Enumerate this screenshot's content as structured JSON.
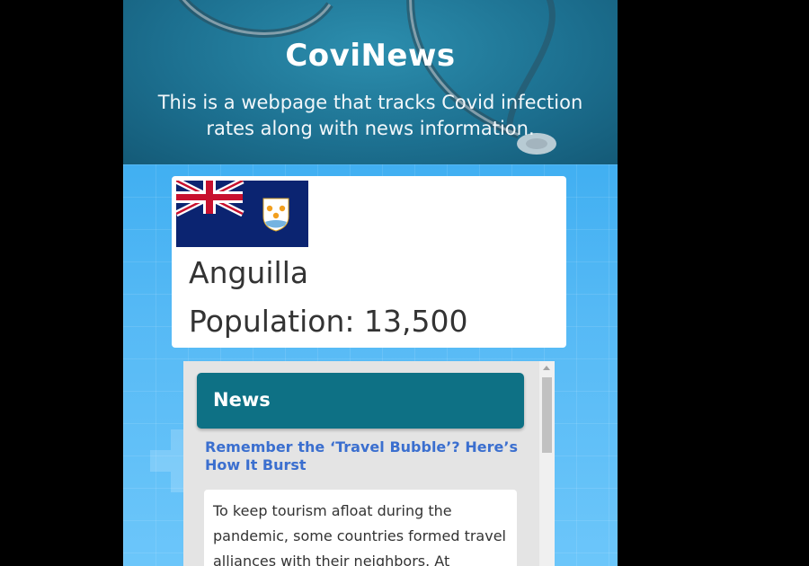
{
  "header": {
    "title": "CoviNews",
    "subtitle": "This is a webpage that tracks Covid infection rates along with news information."
  },
  "country": {
    "name": "Anguilla",
    "population_label": "Population:",
    "population_value": "13,500",
    "flag_icon": "anguilla-flag"
  },
  "news": {
    "heading": "News",
    "articles": [
      {
        "title": "Remember the ‘Travel Bubble’? Here’s How It Burst",
        "summary": "To keep tourism afloat during the pandemic, some countries formed travel alliances with their neighbors. At"
      }
    ]
  },
  "colors": {
    "hero_bg": "#1c6f8f",
    "news_header_bg": "#0e7185",
    "link": "#3b6fcf",
    "page_bg": "#2aa4ee"
  }
}
